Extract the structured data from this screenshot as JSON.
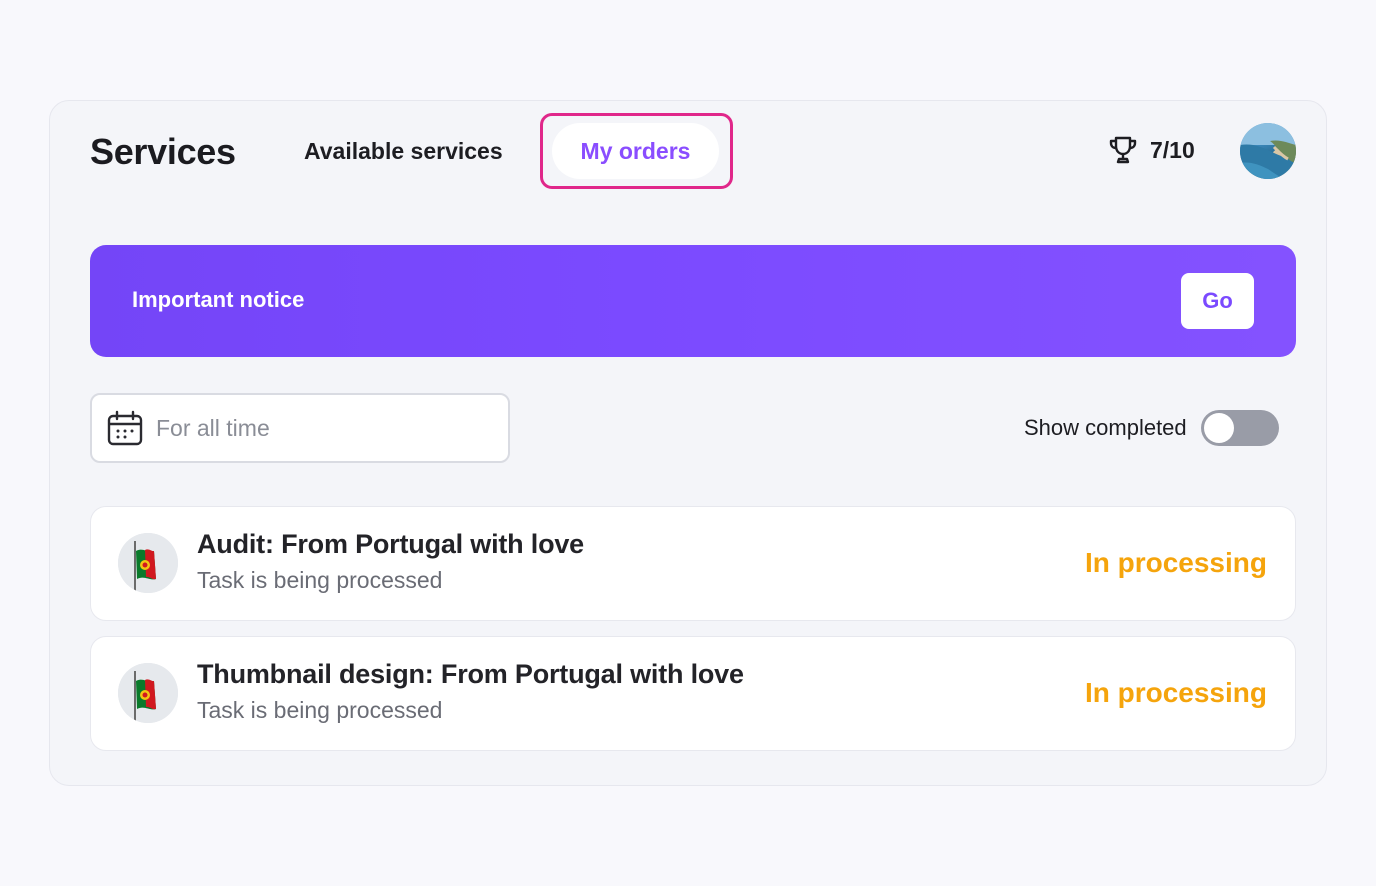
{
  "header": {
    "title": "Services",
    "tabs": [
      {
        "label": "Available services",
        "active": false
      },
      {
        "label": "My orders",
        "active": true
      }
    ],
    "score": "7/10",
    "icons": {
      "score": "trophy-icon",
      "avatar": "avatar"
    }
  },
  "notice": {
    "text": "Important notice",
    "button_label": "Go",
    "color": "#7b4aff"
  },
  "filters": {
    "date_placeholder": "For all time",
    "date_icon": "calendar-icon",
    "show_completed_label": "Show completed",
    "show_completed": false
  },
  "orders": [
    {
      "title": "Audit: From Portugal with love",
      "subtitle": "Task is being processed",
      "status": "In processing",
      "status_color": "#f5a40c",
      "thumbnail": "portugal-flag"
    },
    {
      "title": "Thumbnail design: From Portugal with love",
      "subtitle": "Task is being processed",
      "status": "In processing",
      "status_color": "#f5a40c",
      "thumbnail": "portugal-flag"
    }
  ],
  "colors": {
    "accent": "#8a4dff",
    "highlight": "#e0278a"
  }
}
